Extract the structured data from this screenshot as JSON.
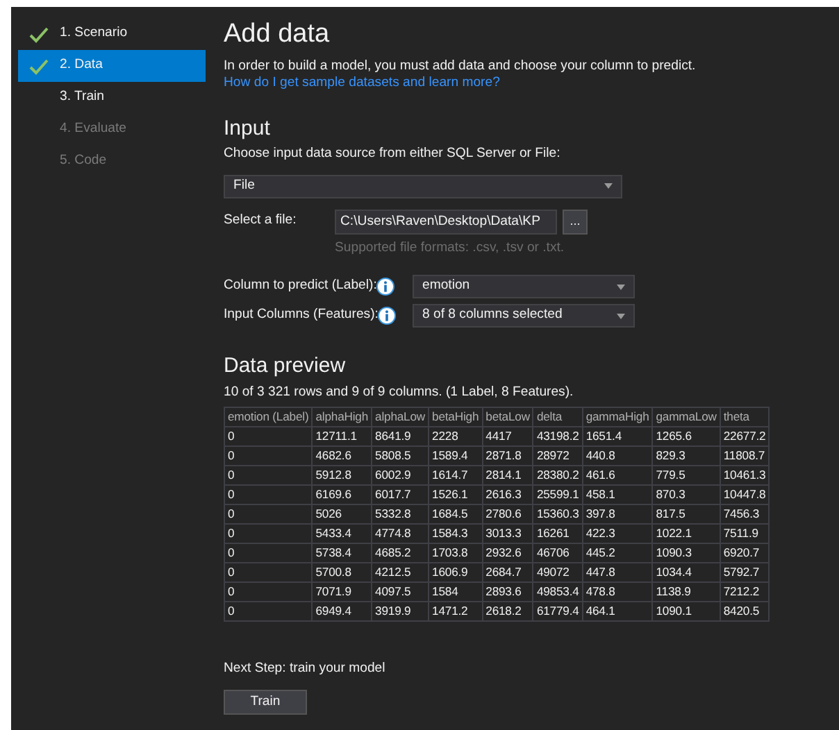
{
  "steps": [
    {
      "label": "1. Scenario",
      "completed": true,
      "selected": false,
      "disabled": false
    },
    {
      "label": "2. Data",
      "completed": true,
      "selected": true,
      "disabled": false
    },
    {
      "label": "3. Train",
      "completed": false,
      "selected": false,
      "disabled": false
    },
    {
      "label": "4. Evaluate",
      "completed": false,
      "selected": false,
      "disabled": true
    },
    {
      "label": "5. Code",
      "completed": false,
      "selected": false,
      "disabled": true
    }
  ],
  "title": "Add data",
  "intro": "In order to build a model, you must add data and choose your column to predict.",
  "help_link": "How do I get sample datasets and learn more?",
  "input": {
    "heading": "Input",
    "prompt": "Choose input data source from either SQL Server or File:",
    "source": "File",
    "file_label": "Select a file:",
    "file_path": "C:\\Users\\Raven\\Desktop\\Data\\KP",
    "browse": "...",
    "formats": "Supported file formats: .csv, .tsv or .txt.",
    "label_field": {
      "label": "Column to predict (Label):",
      "value": "emotion"
    },
    "features_field": {
      "label": "Input Columns (Features):",
      "value": "8 of 8 columns selected"
    }
  },
  "preview": {
    "heading": "Data preview",
    "summary": "10 of 3 321 rows and 9 of 9 columns. (1 Label, 8 Features).",
    "columns": [
      "emotion (Label)",
      "alphaHigh",
      "alphaLow",
      "betaHigh",
      "betaLow",
      "delta",
      "gammaHigh",
      "gammaLow",
      "theta"
    ],
    "rows": [
      [
        "0",
        "12711.1",
        "8641.9",
        "2228",
        "4417",
        "43198.2",
        "1651.4",
        "1265.6",
        "22677.2"
      ],
      [
        "0",
        "4682.6",
        "5808.5",
        "1589.4",
        "2871.8",
        "28972",
        "440.8",
        "829.3",
        "11808.7"
      ],
      [
        "0",
        "5912.8",
        "6002.9",
        "1614.7",
        "2814.1",
        "28380.2",
        "461.6",
        "779.5",
        "10461.3"
      ],
      [
        "0",
        "6169.6",
        "6017.7",
        "1526.1",
        "2616.3",
        "25599.1",
        "458.1",
        "870.3",
        "10447.8"
      ],
      [
        "0",
        "5026",
        "5332.8",
        "1684.5",
        "2780.6",
        "15360.3",
        "397.8",
        "817.5",
        "7456.3"
      ],
      [
        "0",
        "5433.4",
        "4774.8",
        "1584.3",
        "3013.3",
        "16261",
        "422.3",
        "1022.1",
        "7511.9"
      ],
      [
        "0",
        "5738.4",
        "4685.2",
        "1703.8",
        "2932.6",
        "46706",
        "445.2",
        "1090.3",
        "6920.7"
      ],
      [
        "0",
        "5700.8",
        "4212.5",
        "1606.9",
        "2684.7",
        "49072",
        "447.8",
        "1034.4",
        "5792.7"
      ],
      [
        "0",
        "7071.9",
        "4097.5",
        "1584",
        "2893.6",
        "49853.4",
        "478.8",
        "1138.9",
        "7212.2"
      ],
      [
        "0",
        "6949.4",
        "3919.9",
        "1471.2",
        "2618.2",
        "61779.4",
        "464.1",
        "1090.1",
        "8420.5"
      ]
    ]
  },
  "next_step": {
    "text": "Next Step: train your model",
    "button": "Train"
  }
}
